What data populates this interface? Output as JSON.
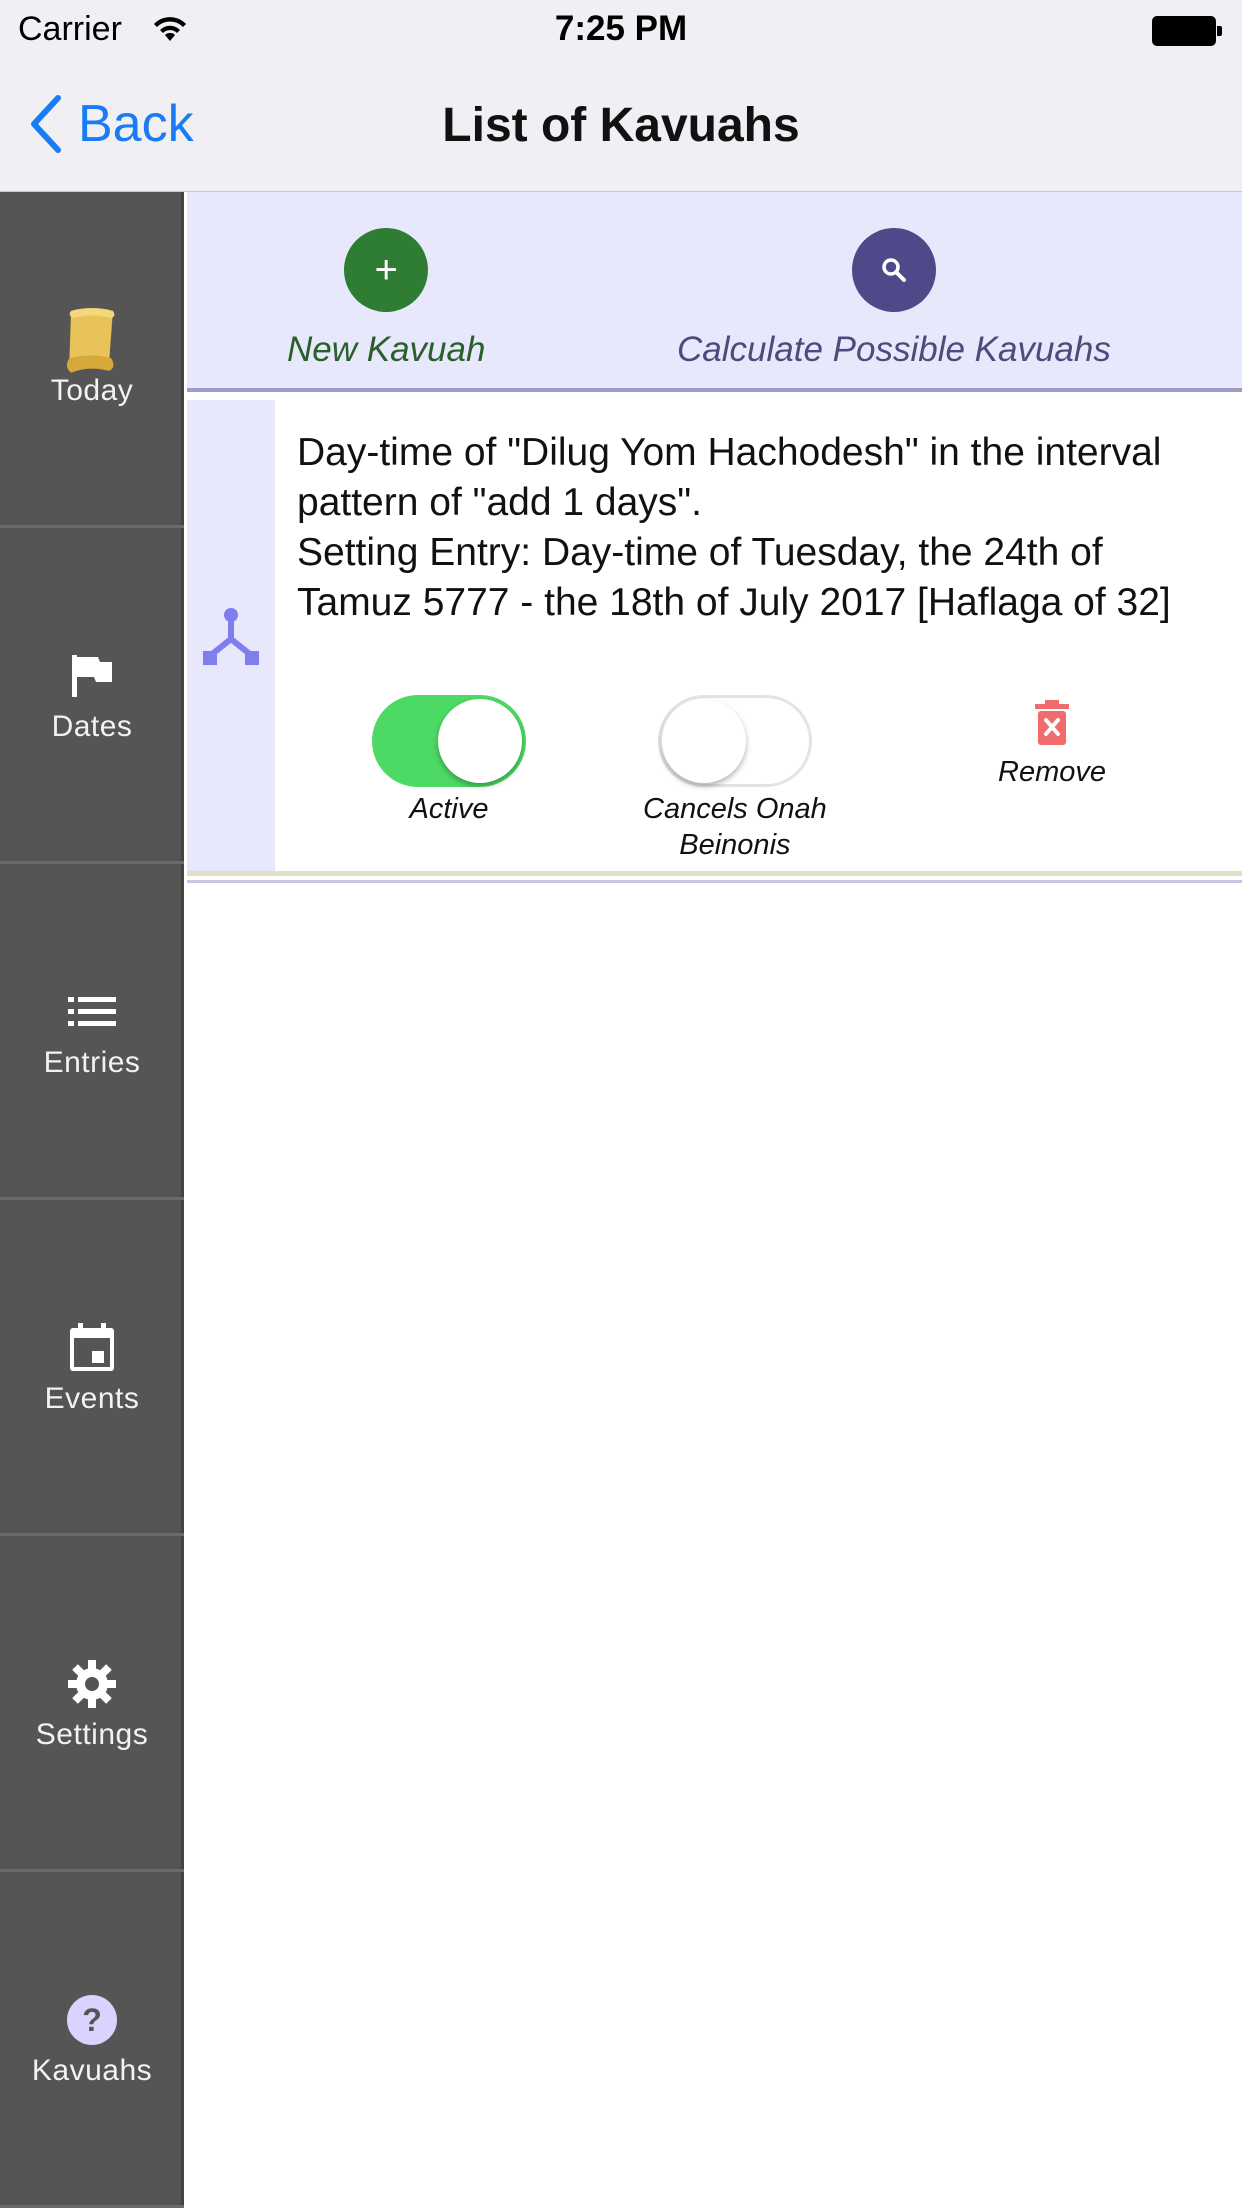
{
  "status_bar": {
    "carrier": "Carrier",
    "time": "7:25 PM"
  },
  "nav": {
    "back_label": "Back",
    "title": "List of Kavuahs"
  },
  "sidebar": {
    "items": [
      {
        "label": "Today",
        "icon": "scroll-icon"
      },
      {
        "label": "Dates",
        "icon": "flag-icon"
      },
      {
        "label": "Entries",
        "icon": "list-icon"
      },
      {
        "label": "Events",
        "icon": "calendar-icon"
      },
      {
        "label": "Settings",
        "icon": "gear-icon"
      },
      {
        "label": "Kavuahs",
        "icon": "question-icon"
      }
    ]
  },
  "actions": {
    "new_label": "New Kavuah",
    "calculate_label": "Calculate Possible Kavuahs",
    "new_color": "#2e7d32",
    "calculate_color": "#4e4a8a"
  },
  "kavuah": {
    "description": "Day-time of \"Dilug Yom Hachodesh\" in the interval pattern of \"add 1 days\".",
    "setting_entry": "Setting Entry: Day-time of Tuesday, the 24th of Tamuz 5777 - the 18th of July 2017 [Haflaga of 32]",
    "active_label": "Active",
    "active_on": true,
    "cancels_label_1": "Cancels Onah",
    "cancels_label_2": "Beinonis",
    "cancels_on": false,
    "remove_label": "Remove"
  },
  "colors": {
    "accent_blue": "#1a7cf5",
    "toggle_on": "#4cd964",
    "remove_red": "#f06b6b",
    "kavuah_icon": "#7e7ef0"
  }
}
